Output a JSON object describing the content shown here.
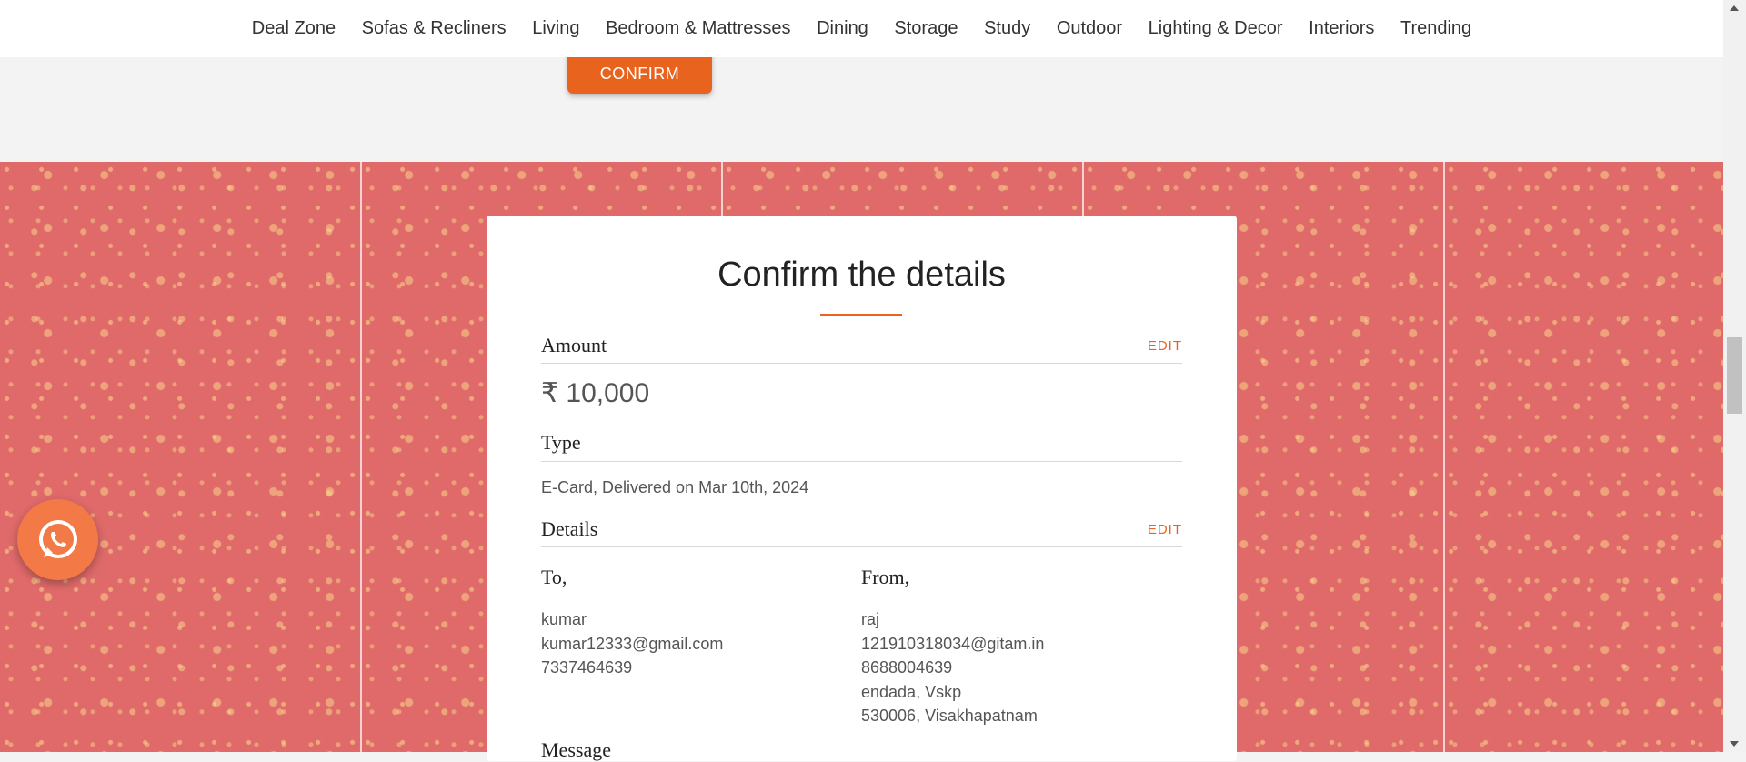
{
  "nav": {
    "items": [
      {
        "label": "Deal Zone"
      },
      {
        "label": "Sofas & Recliners"
      },
      {
        "label": "Living"
      },
      {
        "label": "Bedroom & Mattresses"
      },
      {
        "label": "Dining"
      },
      {
        "label": "Storage"
      },
      {
        "label": "Study"
      },
      {
        "label": "Outdoor"
      },
      {
        "label": "Lighting & Decor"
      },
      {
        "label": "Interiors"
      },
      {
        "label": "Trending"
      }
    ]
  },
  "confirm_button": {
    "label": "CONFIRM"
  },
  "card": {
    "title": "Confirm the details",
    "amount": {
      "label": "Amount",
      "edit": "EDIT",
      "value": "₹ 10,000"
    },
    "type": {
      "label": "Type",
      "value": "E-Card, Delivered on Mar 10th, 2024"
    },
    "details": {
      "label": "Details",
      "edit": "EDIT",
      "to": {
        "heading": "To,",
        "lines": [
          "kumar",
          "kumar12333@gmail.com",
          "7337464639"
        ]
      },
      "from": {
        "heading": "From,",
        "lines": [
          "raj",
          "121910318034@gitam.in",
          "8688004639",
          "endada, Vskp",
          "530006, Visakhapatnam"
        ]
      }
    },
    "message": {
      "label": "Message"
    }
  },
  "colors": {
    "accent": "#e8641e",
    "pattern_bg": "#e06a6a",
    "whatsapp_bg": "#f37a47"
  },
  "icons": {
    "whatsapp": "whatsapp-icon"
  }
}
